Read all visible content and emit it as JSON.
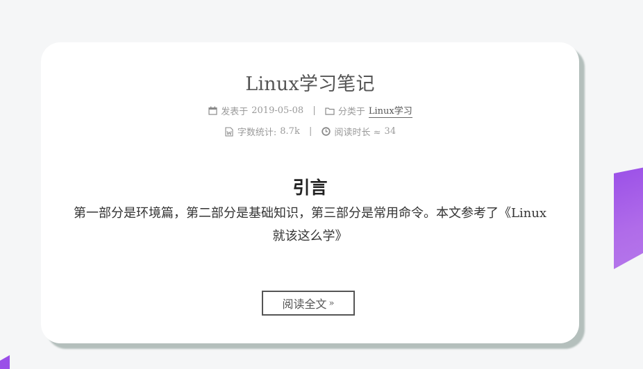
{
  "post": {
    "title": "Linux学习笔记",
    "meta": {
      "posted_label": "发表于",
      "posted_date": "2019-05-08",
      "category_label": "分类于",
      "category_name": "Linux学习",
      "wordcount_label": "字数统计:",
      "wordcount_value": "8.7k",
      "readtime_label": "阅读时长 ≈",
      "readtime_value": "34",
      "separator": "|"
    },
    "section_heading": "引言",
    "excerpt": "第一部分是环境篇，第二部分是基础知识，第三部分是常用命令。本文参考了《Linux就该这么学》",
    "read_more_label": "阅读全文",
    "read_more_arrow": "»"
  },
  "icons": {
    "calendar": "calendar-icon",
    "folder": "folder-icon",
    "file_word": "file-word-icon",
    "clock": "clock-icon"
  },
  "colors": {
    "accent_purple": "#9a4fe8",
    "card_shadow": "#9eaca8",
    "title_text": "#555555",
    "meta_text": "#9a9a9a"
  }
}
